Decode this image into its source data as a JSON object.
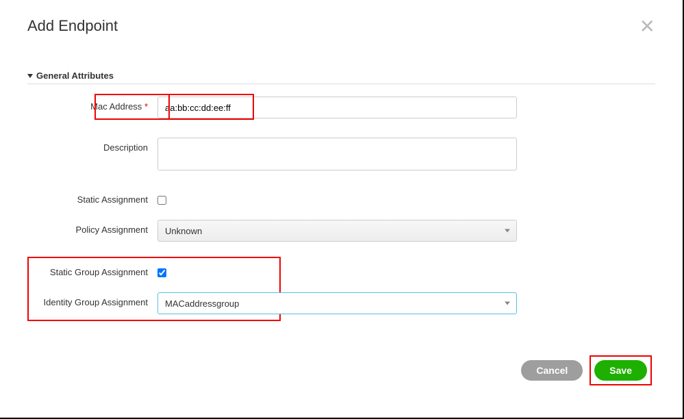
{
  "modal": {
    "title": "Add Endpoint"
  },
  "section": {
    "title": "General Attributes"
  },
  "form": {
    "mac": {
      "label": "Mac Address",
      "required": "*",
      "value": "aa:bb:cc:dd:ee:ff"
    },
    "description": {
      "label": "Description",
      "value": ""
    },
    "staticAssignment": {
      "label": "Static Assignment",
      "checked": false
    },
    "policyAssignment": {
      "label": "Policy Assignment",
      "value": "Unknown"
    },
    "staticGroupAssignment": {
      "label": "Static Group Assignment",
      "checked": true
    },
    "identityGroupAssignment": {
      "label": "Identity Group Assignment",
      "value": "MACaddressgroup"
    }
  },
  "buttons": {
    "cancel": "Cancel",
    "save": "Save"
  }
}
